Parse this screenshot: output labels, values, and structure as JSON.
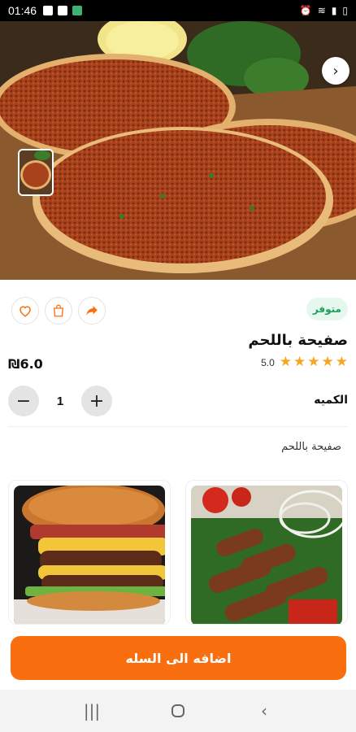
{
  "status_bar": {
    "time": "01:46",
    "left_icons": [
      "image-icon",
      "message-icon",
      "app-icon"
    ],
    "right_icons": [
      "alarm-icon",
      "wifi-icon",
      "signal-icon",
      "battery-icon"
    ]
  },
  "hero": {
    "image": "lahm-bi-ajeen-photo",
    "next_icon": "chevron-right-icon"
  },
  "product": {
    "availability": "متوفر",
    "title": "صفيحة باللحم",
    "price": "₪6.0",
    "rating": "5.0",
    "stars": 5,
    "quantity_label": "الكميه",
    "quantity": "1",
    "description": "صفيحة باللحم"
  },
  "actions": {
    "favorite_icon": "heart-icon",
    "cart_icon": "shopping-bag-icon",
    "share_icon": "share-icon"
  },
  "related": [
    {
      "image": "kebab-skewers-photo"
    },
    {
      "image": "burger-photo"
    }
  ],
  "cart": {
    "button_label": "اضافه الى السله"
  },
  "nav": {
    "recent_icon": "recent-apps-icon",
    "home_icon": "home-icon",
    "back_icon": "back-icon"
  },
  "colors": {
    "accent": "#f96f0f",
    "available_bg": "#e6f7ef",
    "available_text": "#1a9e5c",
    "star": "#f5a623"
  }
}
